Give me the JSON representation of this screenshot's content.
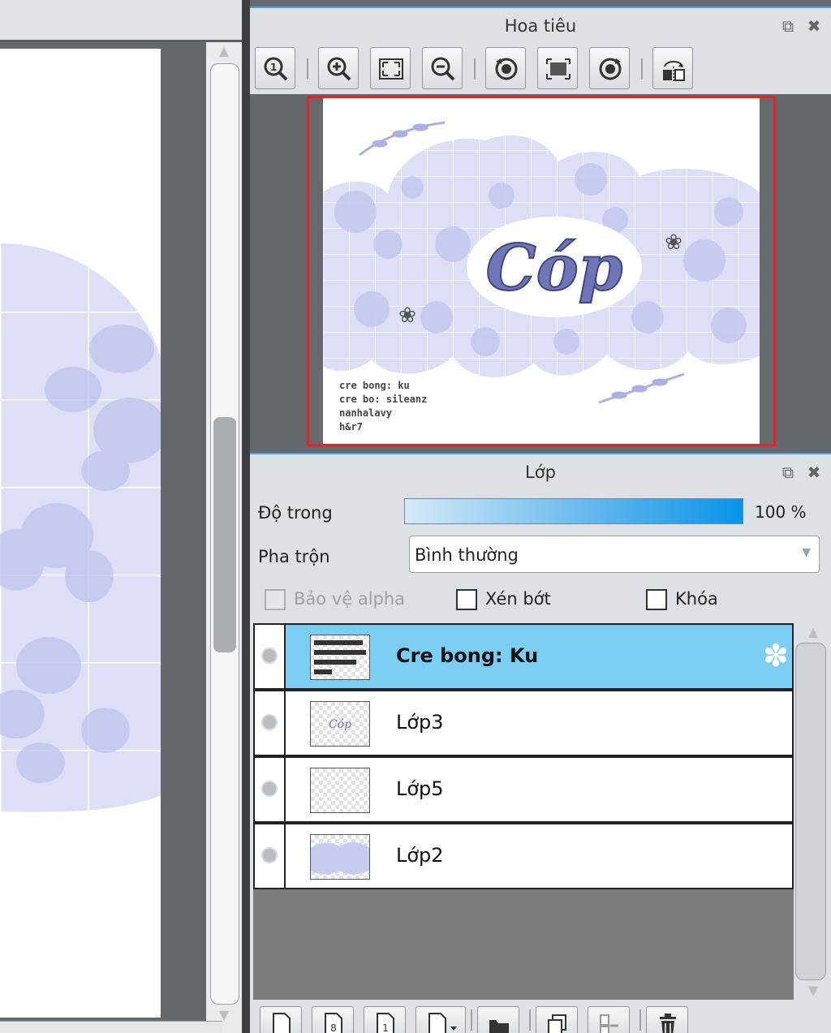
{
  "navigator": {
    "title": "Hoa tiêu",
    "preview_caption": [
      "cre bong: ku",
      "cre bo: sileanz",
      "nanhalavy",
      "h&r7"
    ],
    "artwork_text": "Cóp"
  },
  "layers_panel": {
    "title": "Lớp",
    "opacity_label": "Độ trong",
    "opacity_value": "100 %",
    "opacity_fraction": 1.0,
    "blend_label": "Pha trộn",
    "blend_value": "Bình thường",
    "protect_alpha_label": "Bảo vệ alpha",
    "clip_label": "Xén bớt",
    "lock_label": "Khóa",
    "layers": [
      {
        "name": "Cre bong: Ku",
        "selected": true
      },
      {
        "name": "Lớp3",
        "selected": false
      },
      {
        "name": "Lớp5",
        "selected": false
      },
      {
        "name": "Lớp2",
        "selected": false
      }
    ]
  },
  "colors": {
    "selection": "#7ccdf2",
    "nav_border": "#e32424",
    "accent": "#0a93e8",
    "artwork_lavender": "#d9dcf5"
  }
}
